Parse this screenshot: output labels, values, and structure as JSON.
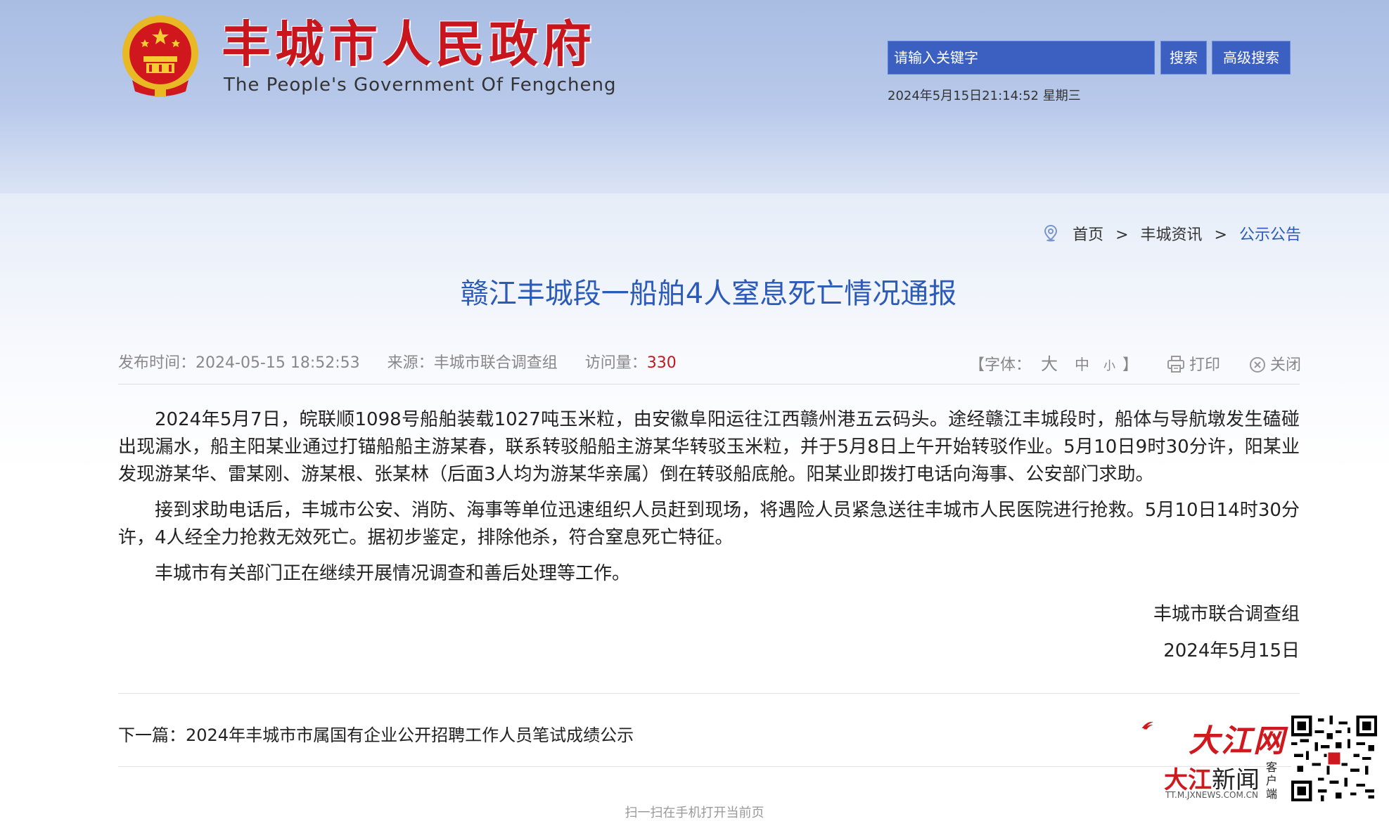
{
  "header": {
    "site_title": "丰城市人民政府",
    "site_subtitle": "The People's Government Of Fengcheng",
    "search_placeholder": "请输入关键字",
    "search_button": "搜索",
    "advanced_search_button": "高级搜索",
    "datetime": "2024年5月15日21:14:52 星期三"
  },
  "breadcrumb": {
    "home": "首页",
    "section": "丰城资讯",
    "current": "公示公告",
    "separator": ">"
  },
  "article": {
    "title": "赣江丰城段一船舶4人窒息死亡情况通报",
    "publish_label": "发布时间：",
    "publish_time": "2024-05-15 18:52:53",
    "source_label": "来源：",
    "source": "丰城市联合调查组",
    "views_label": "访问量：",
    "views": "330",
    "paragraphs": [
      "2024年5月7日，皖联顺1098号船舶装载1027吨玉米粒，由安徽阜阳运往江西赣州港五云码头。途经赣江丰城段时，船体与导航墩发生磕碰出现漏水，船主阳某业通过打锚船船主游某春，联系转驳船船主游某华转驳玉米粒，并于5月8日上午开始转驳作业。5月10日9时30分许，阳某业发现游某华、雷某刚、游某根、张某林（后面3人均为游某华亲属）倒在转驳船底舱。阳某业即拨打电话向海事、公安部门求助。",
      "接到求助电话后，丰城市公安、消防、海事等单位迅速组织人员赶到现场，将遇险人员紧急送往丰城市人民医院进行抢救。5月10日14时30分许，4人经全力抢救无效死亡。据初步鉴定，排除他杀，符合窒息死亡特征。",
      "丰城市有关部门正在继续开展情况调查和善后处理等工作。"
    ],
    "signature": "丰城市联合调查组",
    "sign_date": "2024年5月15日"
  },
  "tools": {
    "font_open": "【字体：",
    "font_large": "大",
    "font_medium": "中",
    "font_small": "小",
    "font_close": "】",
    "print": "打印",
    "close": "关闭"
  },
  "footer": {
    "next_label": "下一篇：",
    "next_title": "2024年丰城市市属国有企业公开招聘工作人员笔试成绩公示",
    "scan_hint": "扫一扫在手机打开当前页"
  },
  "watermark": {
    "brand": "大江网",
    "app_name_red": "大江",
    "app_name": "新闻",
    "client_label": "客户端",
    "url": "TT.M.JXNEWS.COM.CN"
  },
  "colors": {
    "brand_red": "#c8161e",
    "link_blue": "#2b5ab8",
    "search_blue": "#3c60c2"
  }
}
